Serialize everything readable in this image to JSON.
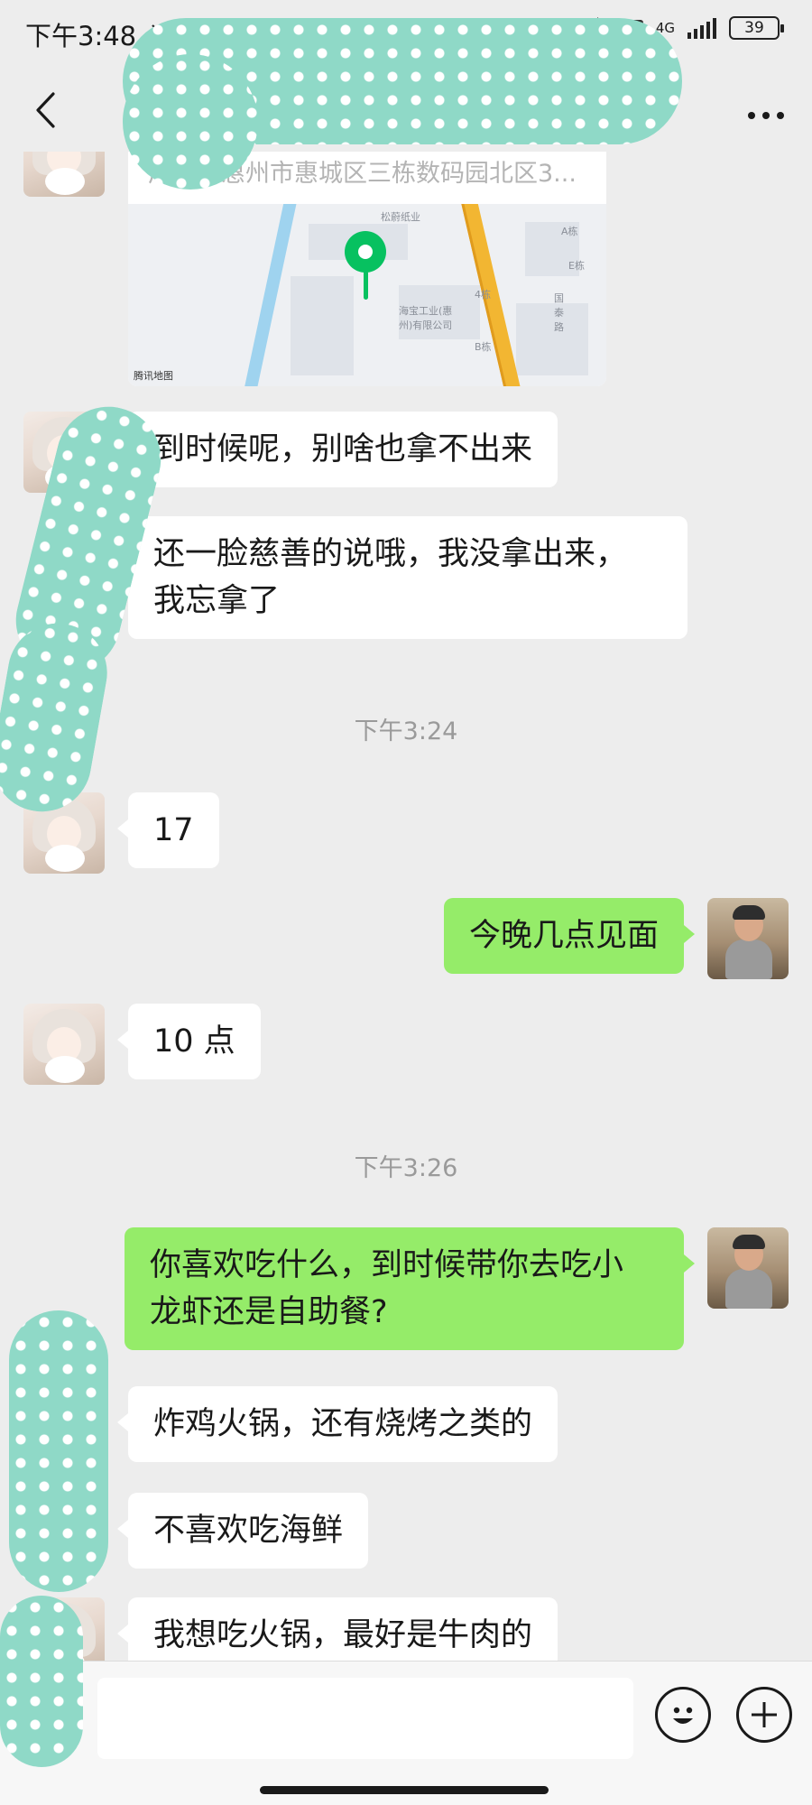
{
  "status_bar": {
    "time": "下午3:48",
    "network": "4G",
    "hd": "HD",
    "battery": "39"
  },
  "location": {
    "address": "广东省惠州市惠城区三栋数码园北区3...",
    "map_labels": [
      "松蔚纸业",
      "海宝工业(惠州)有限公司",
      "A栋",
      "E栋",
      "B栋",
      "4栋",
      "国泰路"
    ],
    "map_brand": "腾讯地图"
  },
  "messages": [
    {
      "side": "left",
      "text": "到时候呢，别啥也拿不出来"
    },
    {
      "side": "left",
      "text": "还一脸慈善的说哦，我没拿出来，\n我忘拿了"
    },
    {
      "type": "time",
      "text": "下午3:24"
    },
    {
      "side": "left",
      "text": "17"
    },
    {
      "side": "right",
      "text": "今晚几点见面"
    },
    {
      "side": "left",
      "text": "10 点"
    },
    {
      "type": "time",
      "text": "下午3:26"
    },
    {
      "side": "right",
      "text": "你喜欢吃什么，到时候带你去吃小\n龙虾还是自助餐?"
    },
    {
      "side": "left",
      "text": "炸鸡火锅，还有烧烤之类的"
    },
    {
      "side": "left",
      "text": "不喜欢吃海鲜"
    },
    {
      "side": "left",
      "text": "我想吃火锅，最好是牛肉的"
    }
  ],
  "icons": {
    "back": "chevron-left-icon",
    "more": "more-dots-icon",
    "voice": "voice-icon",
    "emoji": "emoji-icon",
    "plus": "plus-icon"
  },
  "colors": {
    "background": "#ededed",
    "my_bubble": "#95ec69",
    "their_bubble": "#ffffff",
    "pin": "#07c160"
  }
}
